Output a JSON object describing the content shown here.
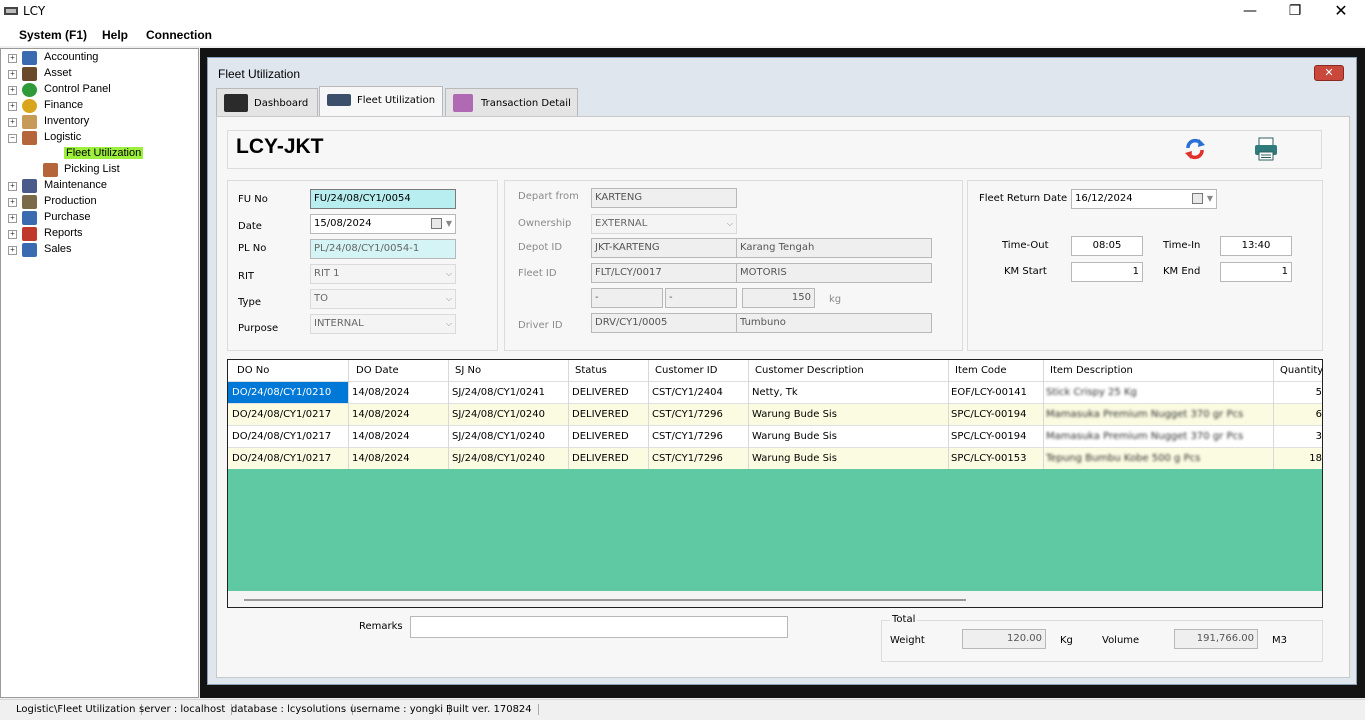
{
  "app": {
    "title": "LCY"
  },
  "menu": {
    "system": "System (F1)",
    "help": "Help",
    "connection": "Connection"
  },
  "tree": [
    {
      "label": "Accounting",
      "expander": "+",
      "color": "#3a6bb0"
    },
    {
      "label": "Asset",
      "expander": "+",
      "color": "#6b4a2a"
    },
    {
      "label": "Control Panel",
      "expander": "+",
      "color": "#2e9a3a"
    },
    {
      "label": "Finance",
      "expander": "+",
      "color": "#d9a51c"
    },
    {
      "label": "Inventory",
      "expander": "+",
      "color": "#c89a58"
    },
    {
      "label": "Logistic",
      "expander": "−",
      "color": "#b5653a"
    },
    {
      "label": "Fleet Utilization",
      "color": "#8a4a2a"
    },
    {
      "label": "Picking List",
      "color": "#b5653a"
    },
    {
      "label": "Maintenance",
      "expander": "+",
      "color": "#4a5a8a"
    },
    {
      "label": "Production",
      "expander": "+",
      "color": "#7a6a4a"
    },
    {
      "label": "Purchase",
      "expander": "+",
      "color": "#3a6bb0"
    },
    {
      "label": "Reports",
      "expander": "+",
      "color": "#c0392b"
    },
    {
      "label": "Sales",
      "expander": "+",
      "color": "#3a6bb0"
    }
  ],
  "window": {
    "title": "Fleet Utilization",
    "close": "✕"
  },
  "tabs": [
    {
      "label": "Dashboard"
    },
    {
      "label": "Fleet Utilization"
    },
    {
      "label": "Transaction Detail"
    }
  ],
  "header": {
    "title": "LCY-JKT"
  },
  "form_left": {
    "fu_no_label": "FU No",
    "fu_no": "FU/24/08/CY1/0054",
    "date_label": "Date",
    "date": "15/08/2024",
    "pl_no_label": "PL No",
    "pl_no": "PL/24/08/CY1/0054-1",
    "rit_label": "RIT",
    "rit": "RIT 1",
    "type_label": "Type",
    "type": "TO",
    "purpose_label": "Purpose",
    "purpose": "INTERNAL"
  },
  "form_mid": {
    "depart_label": "Depart from",
    "depart": "KARTENG",
    "ownership_label": "Ownership",
    "ownership": "EXTERNAL",
    "depot_label": "Depot ID",
    "depot_id": "JKT-KARTENG",
    "depot_name": "Karang Tengah",
    "fleet_label": "Fleet ID",
    "fleet_id": "FLT/LCY/0017",
    "fleet_name": "MOTORIS",
    "dim1": "-",
    "dim2": "-",
    "capacity": "150",
    "capacity_unit": "kg",
    "driver_label": "Driver ID",
    "driver_id": "DRV/CY1/0005",
    "driver_name": "Tumbuno"
  },
  "form_right": {
    "return_label": "Fleet Return Date",
    "return_date": "16/12/2024",
    "timeout_label": "Time-Out",
    "timeout": "08:05",
    "timein_label": "Time-In",
    "timein": "13:40",
    "kmstart_label": "KM Start",
    "kmstart": "1",
    "kmend_label": "KM End",
    "kmend": "1"
  },
  "grid": {
    "columns": [
      "DO No",
      "DO Date",
      "SJ No",
      "Status",
      "Customer ID",
      "Customer Description",
      "Item Code",
      "Item Description",
      "Quantity"
    ],
    "rows": [
      {
        "do_no": "DO/24/08/CY1/0210",
        "do_date": "14/08/2024",
        "sj_no": "SJ/24/08/CY1/0241",
        "status": "DELIVERED",
        "cust_id": "CST/CY1/2404",
        "cust_desc": "Netty, Tk",
        "item_code": "EOF/LCY-00141",
        "item_desc": "Stick Crispy 25 Kg",
        "qty": "5"
      },
      {
        "do_no": "DO/24/08/CY1/0217",
        "do_date": "14/08/2024",
        "sj_no": "SJ/24/08/CY1/0240",
        "status": "DELIVERED",
        "cust_id": "CST/CY1/7296",
        "cust_desc": "Warung Bude Sis",
        "item_code": "SPC/LCY-00194",
        "item_desc": "Mamasuka Premium Nugget 370 gr Pcs",
        "qty": "6"
      },
      {
        "do_no": "DO/24/08/CY1/0217",
        "do_date": "14/08/2024",
        "sj_no": "SJ/24/08/CY1/0240",
        "status": "DELIVERED",
        "cust_id": "CST/CY1/7296",
        "cust_desc": "Warung Bude Sis",
        "item_code": "SPC/LCY-00194",
        "item_desc": "Mamasuka Premium Nugget 370 gr Pcs",
        "qty": "3"
      },
      {
        "do_no": "DO/24/08/CY1/0217",
        "do_date": "14/08/2024",
        "sj_no": "SJ/24/08/CY1/0240",
        "status": "DELIVERED",
        "cust_id": "CST/CY1/7296",
        "cust_desc": "Warung Bude Sis",
        "item_code": "SPC/LCY-00153",
        "item_desc": "Tepung Bumbu Kobe 500 g Pcs",
        "qty": "18"
      }
    ]
  },
  "footer": {
    "remarks_label": "Remarks",
    "remarks": "",
    "total_label": "Total",
    "weight_label": "Weight",
    "weight": "120.00",
    "weight_unit": "Kg",
    "volume_label": "Volume",
    "volume": "191,766.00",
    "volume_unit": "M3"
  },
  "status": {
    "path": "Logistic\\Fleet Utilization",
    "server": "server : localhost",
    "database": "database : lcysolutions",
    "username": "username : yongki",
    "build": "Built ver. 170824"
  }
}
